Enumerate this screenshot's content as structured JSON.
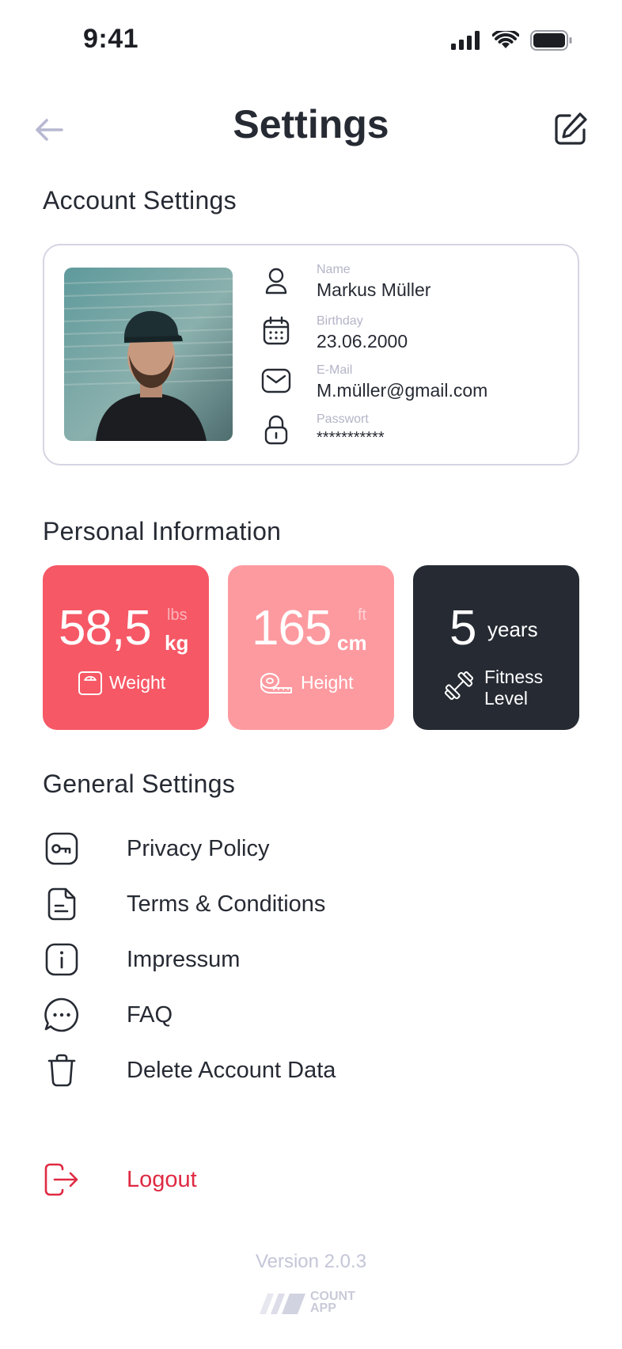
{
  "status_bar": {
    "time": "9:41"
  },
  "header": {
    "title": "Settings"
  },
  "account_settings": {
    "title": "Account Settings",
    "fields": [
      {
        "label": "Name",
        "value": "Markus Müller",
        "icon": "user-icon"
      },
      {
        "label": "Birthday",
        "value": "23.06.2000",
        "icon": "calendar-icon"
      },
      {
        "label": "E-Mail",
        "value": "M.müller@gmail.com",
        "icon": "mail-icon"
      },
      {
        "label": "Passwort",
        "value": "***********",
        "icon": "lock-icon"
      }
    ]
  },
  "personal_info": {
    "title": "Personal Information",
    "weight": {
      "value": "58,5",
      "unit": "kg",
      "alt_unit": "lbs",
      "label": "Weight",
      "icon": "scale-icon"
    },
    "height": {
      "value": "165",
      "unit": "cm",
      "alt_unit": "ft",
      "label": "Height",
      "icon": "tape-measure-icon"
    },
    "fitness": {
      "value": "5",
      "unit": "years",
      "label_line1": "Fitness",
      "label_line2": "Level",
      "icon": "dumbbell-icon"
    }
  },
  "general_settings": {
    "title": "General Settings",
    "items": [
      {
        "label": "Privacy Policy",
        "icon": "key-icon"
      },
      {
        "label": "Terms & Conditions",
        "icon": "document-icon"
      },
      {
        "label": "Impressum",
        "icon": "info-icon"
      },
      {
        "label": "FAQ",
        "icon": "chat-icon"
      },
      {
        "label": "Delete Account Data",
        "icon": "trash-icon"
      }
    ]
  },
  "logout": {
    "label": "Logout",
    "icon": "logout-icon"
  },
  "footer": {
    "version": "Version 2.0.3",
    "brand_line1": "COUNT",
    "brand_line2": "APP"
  },
  "colors": {
    "weight_tile": "#f65866",
    "height_tile": "#fd9aa0",
    "fitness_tile": "#262a33",
    "logout": "#df2a42",
    "text": "#262a33"
  }
}
